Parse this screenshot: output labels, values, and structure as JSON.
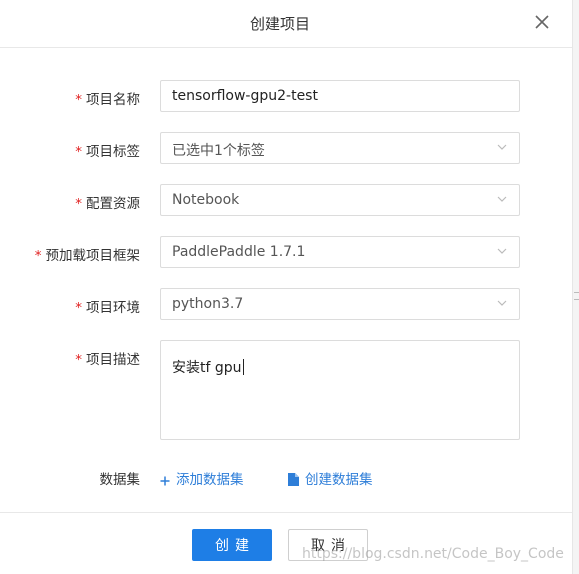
{
  "dialog": {
    "title": "创建项目",
    "close_icon": "close-icon"
  },
  "form": {
    "required_mark": "*",
    "name": {
      "label": "项目名称",
      "value": "tensorflow-gpu2-test"
    },
    "tags": {
      "label": "项目标签",
      "value": "已选中1个标签"
    },
    "resource": {
      "label": "配置资源",
      "value": "Notebook"
    },
    "framework": {
      "label": "预加载项目框架",
      "value": "PaddlePaddle 1.7.1"
    },
    "env": {
      "label": "项目环境",
      "value": "python3.7"
    },
    "desc": {
      "label": "项目描述",
      "value": "安装tf gpu"
    },
    "dataset": {
      "label": "数据集",
      "add_label": "添加数据集",
      "create_label": "创建数据集",
      "add_icon": "plus-icon",
      "create_icon": "file-icon"
    }
  },
  "footer": {
    "create_label": "创建",
    "cancel_label": "取消"
  },
  "watermark": "https://blog.csdn.net/Code_Boy_Code",
  "colors": {
    "accent": "#1e7ee6",
    "link": "#2e7ed8",
    "required": "#e02020"
  }
}
